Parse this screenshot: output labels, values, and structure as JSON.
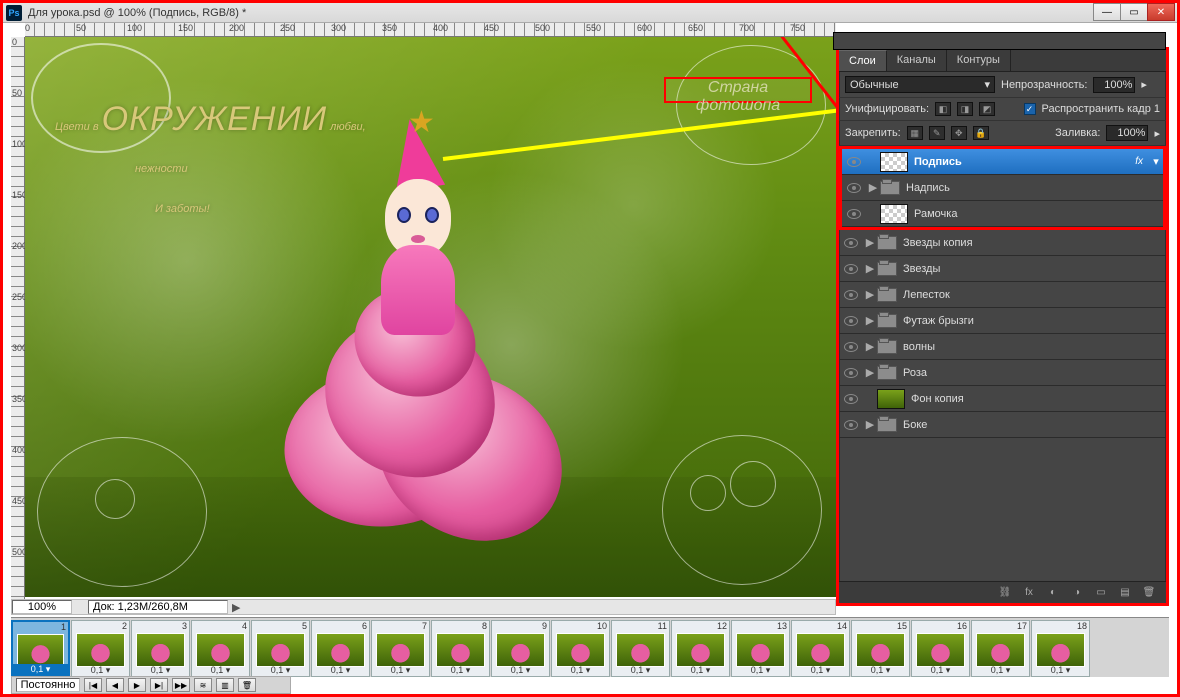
{
  "title": "Для урока.psd @ 100% (Подпись, RGB/8) *",
  "ruler_h": [
    0,
    50,
    100,
    150,
    200,
    250,
    300,
    350,
    400,
    450,
    500,
    550,
    600,
    650,
    700,
    750
  ],
  "ruler_v": [
    0,
    50,
    100,
    150,
    200,
    250,
    300,
    350,
    400,
    450,
    500
  ],
  "headline_l1_a": "Цвети в ",
  "headline_l1_b": "ОКРУЖЕНИИ",
  "headline_l1_c": " любви,",
  "headline_l2": "нежности",
  "headline_l3": "И   заботы!",
  "watermark": "Страна фотошопа",
  "zoom": "100%",
  "docinfo": "Док: 1,23M/260,8M",
  "frames": [
    {
      "n": 1,
      "dur": "0,1",
      "sel": true
    },
    {
      "n": 2,
      "dur": "0,1"
    },
    {
      "n": 3,
      "dur": "0,1"
    },
    {
      "n": 4,
      "dur": "0,1"
    },
    {
      "n": 5,
      "dur": "0,1"
    },
    {
      "n": 6,
      "dur": "0,1"
    },
    {
      "n": 7,
      "dur": "0,1"
    },
    {
      "n": 8,
      "dur": "0,1"
    },
    {
      "n": 9,
      "dur": "0,1"
    },
    {
      "n": 10,
      "dur": "0,1"
    },
    {
      "n": 11,
      "dur": "0,1"
    },
    {
      "n": 12,
      "dur": "0,1"
    },
    {
      "n": 13,
      "dur": "0,1"
    },
    {
      "n": 14,
      "dur": "0,1"
    },
    {
      "n": 15,
      "dur": "0,1"
    },
    {
      "n": 16,
      "dur": "0,1"
    },
    {
      "n": 17,
      "dur": "0,1"
    },
    {
      "n": 18,
      "dur": "0,1"
    }
  ],
  "loop": "Постоянно",
  "panel_tabs": {
    "layers": "Слои",
    "channels": "Каналы",
    "paths": "Контуры"
  },
  "blend": {
    "label": "Обычные",
    "opacity_label": "Непрозрачность:",
    "opacity": "100%"
  },
  "unify": {
    "label": "Унифицировать:",
    "propagate": "Распространить кадр 1"
  },
  "lock": {
    "label": "Закрепить:",
    "fill_label": "Заливка:",
    "fill": "100%"
  },
  "layers": [
    {
      "name": "Подпись",
      "sel": true,
      "thumb": "trans",
      "fx": true
    },
    {
      "name": "Надпись",
      "folder": true,
      "collapsed": true
    },
    {
      "name": "Рамочка",
      "thumb": "trans"
    },
    {
      "name": "Звезды копия",
      "folder": true,
      "collapsed": true
    },
    {
      "name": "Звезды",
      "folder": true,
      "collapsed": true
    },
    {
      "name": "Лепесток",
      "folder": true,
      "collapsed": true
    },
    {
      "name": "Футаж брызги",
      "folder": true,
      "collapsed": true
    },
    {
      "name": "волны",
      "folder": true,
      "collapsed": true
    },
    {
      "name": "Роза",
      "folder": true,
      "collapsed": true
    },
    {
      "name": "Фон копия",
      "thumb": "green"
    },
    {
      "name": "Боке",
      "folder": true,
      "collapsed": true
    }
  ],
  "fx_label": "fx"
}
